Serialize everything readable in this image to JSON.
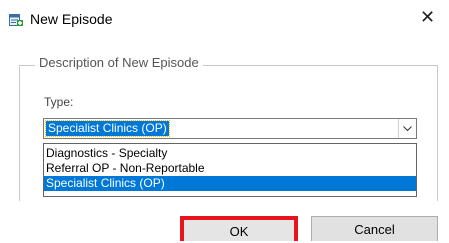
{
  "dialog": {
    "title": "New Episode",
    "close_label": "✕"
  },
  "group": {
    "legend": "Description of New Episode",
    "type_label": "Type:"
  },
  "combo": {
    "selected_value": "Specialist Clinics (OP)",
    "options": [
      "Diagnostics - Specialty",
      "Referral OP - Non-Reportable",
      "Specialist Clinics (OP)"
    ],
    "highlighted_index": 2
  },
  "buttons": {
    "ok_label": "OK",
    "cancel_label": "Cancel"
  },
  "colors": {
    "selection": "#0078d7",
    "highlight_border": "#e8141c"
  },
  "icons": {
    "app": "new-episode-icon",
    "close": "close-icon",
    "dropdown": "chevron-down-icon"
  }
}
